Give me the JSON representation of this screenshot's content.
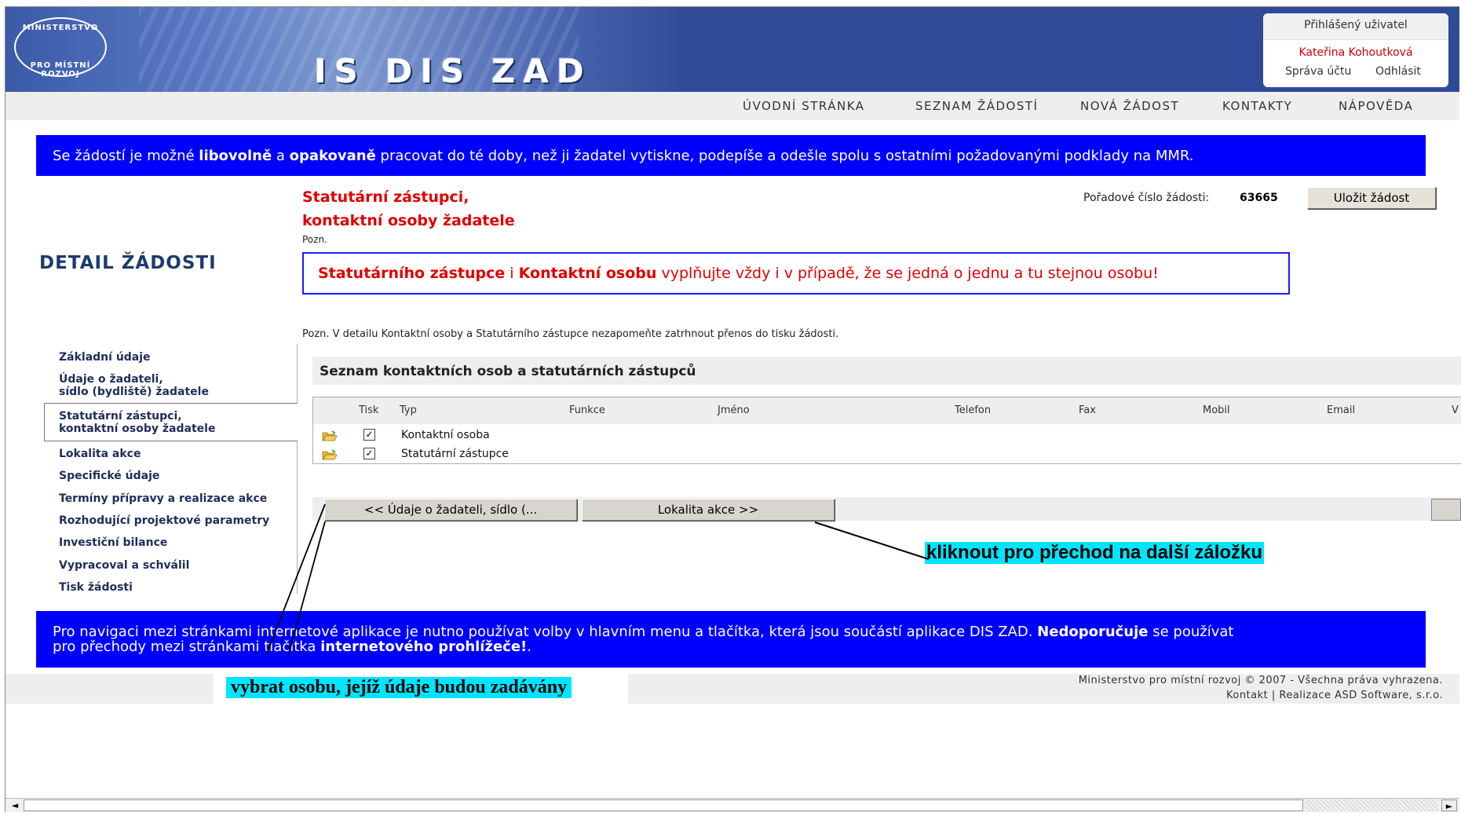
{
  "header": {
    "logo_top": "MINISTERSTVO",
    "logo_bottom": "PRO MÍSTNÍ ROZVOJ",
    "app_title": "IS DIS ZAD"
  },
  "user": {
    "label": "Přihlášený uživatel",
    "name": "Kateřina Kohoutková",
    "account_link": "Správa účtu",
    "logout_link": "Odhlásit"
  },
  "topnav": [
    "ÚVODNÍ STRÁNKA",
    "SEZNAM ŽÁDOSTÍ",
    "NOVÁ ŽÁDOST",
    "KONTAKTY",
    "NÁPOVĚDA"
  ],
  "info_banner": {
    "t1": "Se žádostí je možné ",
    "b1": "libovolně",
    "t2": " a ",
    "b2": "opakovaně",
    "t3": " pracovat do té doby, než ji žadatel vytiskne, podepíše a odešle spolu s ostatními požadovanými podklady na MMR."
  },
  "section": {
    "title_line1": "Statutární zástupci,",
    "title_line2": "kontaktní osoby žadatele",
    "pozn": "Pozn.",
    "order_label": "Pořadové číslo žádosti:",
    "order_number": "63665",
    "save_button": "Uložit žádost",
    "detail_title": "DETAIL ŽÁDOSTI",
    "warning_b1": "Statutárního zástupce",
    "warning_t1": " i ",
    "warning_b2": "Kontaktní osobu",
    "warning_t2": " vyplňujte vždy i v případě, že se jedná o jednu a tu stejnou osobu!",
    "pozn_detail": "Pozn. V detailu Kontaktní osoby a Statutárního zástupce nezapomeňte zatrhnout přenos do tisku žádosti."
  },
  "leftnav": [
    {
      "line1": "Základní údaje",
      "line2": ""
    },
    {
      "line1": "Údaje o žadateli,",
      "line2": "sídlo (bydliště) žadatele"
    },
    {
      "line1": "Statutární zástupci,",
      "line2": "kontaktní osoby žadatele"
    },
    {
      "line1": "Lokalita akce",
      "line2": ""
    },
    {
      "line1": "Specifické údaje",
      "line2": ""
    },
    {
      "line1": "Termíny přípravy a realizace akce",
      "line2": ""
    },
    {
      "line1": "Rozhodující projektové parametry",
      "line2": ""
    },
    {
      "line1": "Investiční bilance",
      "line2": ""
    },
    {
      "line1": "Vypracoval a schválil",
      "line2": ""
    },
    {
      "line1": "Tisk žádosti",
      "line2": ""
    }
  ],
  "list": {
    "title": "Seznam kontaktních osob a statutárních zástupců",
    "columns": [
      "Tisk",
      "Typ",
      "Funkce",
      "Jméno",
      "Telefon",
      "Fax",
      "Mobil",
      "Email",
      "V"
    ],
    "rows": [
      {
        "tisk": "checked",
        "typ": "Kontaktní osoba"
      },
      {
        "tisk": "checked",
        "typ": "Statutární zástupce"
      }
    ]
  },
  "pager": {
    "prev": "<<  Údaje o žadateli, sídlo (...",
    "next": "Lokalita akce  >>"
  },
  "annotations": {
    "next_hint": "kliknout pro přechod na další záložku",
    "select_hint_part1": "vybrat osobu, ",
    "select_hint_part2": "jejíž údaje budou zadávány"
  },
  "bottom_banner": {
    "line1_t": "Pro navigaci mezi stránkami internetové aplikace je nutno používat volby v hlavním menu a tlačítka, která jsou součástí aplikace DIS ZAD. ",
    "line1_b": "Nedoporučuje",
    "line1_t2": " se používat",
    "line2_t": "pro přechody mezi stránkami tlačítka ",
    "line2_b": "internetového prohlížeče!",
    "line2_t2": "."
  },
  "footer": {
    "line1": "Ministerstvo pro místní rozvoj © 2007 - Všechna práva vyhrazena.",
    "line2": "Kontakt | Realizace ASD Software, s.r.o."
  },
  "colors": {
    "header_bg": "#2f4a96",
    "info_bg": "#0000ff",
    "title_red": "#e00000",
    "callout_bg": "#00e5ff"
  }
}
